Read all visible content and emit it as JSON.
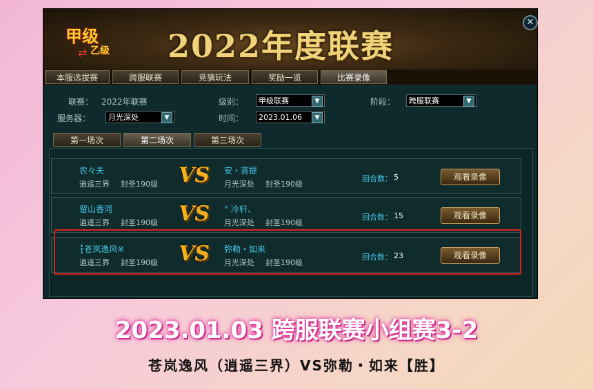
{
  "window": {
    "banner_title": "2022年度联赛",
    "logo_top": "甲级",
    "logo_bottom": "乙级",
    "close_icon": "close-icon"
  },
  "tabs": [
    {
      "label": "本服选拔赛"
    },
    {
      "label": "跨服联赛"
    },
    {
      "label": "竞猜玩法"
    },
    {
      "label": "奖励一览"
    },
    {
      "label": "比赛录像",
      "active": true
    }
  ],
  "filters": {
    "league_label": "联赛：",
    "league_value": "2022年联赛",
    "server_label": "服务器：",
    "server_value": "月光深处",
    "level_label": "级别：",
    "level_value": "甲级联赛",
    "time_label": "时间：",
    "time_value": "2023.01.06",
    "stage_label": "阶段：",
    "stage_value": "跨服联赛"
  },
  "subtabs": [
    {
      "label": "第一场次"
    },
    {
      "label": "第二场次",
      "active": true
    },
    {
      "label": "第三场次"
    }
  ],
  "matches": [
    {
      "p1_name": "农々夫",
      "p1_server": "逍遥三界",
      "p1_rank": "封圣190级",
      "p2_name": "安・菩提",
      "p2_server": "月光深处",
      "p2_rank": "封圣190级",
      "rounds_label": "回合数：",
      "rounds": "5",
      "watch": "观看录像"
    },
    {
      "p1_name": "留山香河",
      "p1_server": "逍遥三界",
      "p1_rank": "封圣190级",
      "p2_name": "° 冷轩、",
      "p2_server": "月光深处",
      "p2_rank": "封圣190级",
      "rounds_label": "回合数：",
      "rounds": "15",
      "watch": "观看录像"
    },
    {
      "p1_name": "┇苍岚逸风※",
      "p1_server": "逍遥三界",
      "p1_rank": "封圣190级",
      "p2_name": "弥勒・如来",
      "p2_server": "月光深处",
      "p2_rank": "封圣190级",
      "rounds_label": "回合数：",
      "rounds": "23",
      "watch": "观看录像"
    }
  ],
  "vs_text": "VS",
  "caption": {
    "line1": "2023.01.03 跨服联赛小组赛3-2",
    "line2": "苍岚逸风（逍遥三界）VS弥勒・如来【胜】"
  },
  "colors": {
    "highlight": "#e02020",
    "player_name": "#46c6e6",
    "vs": "#f0b020"
  }
}
